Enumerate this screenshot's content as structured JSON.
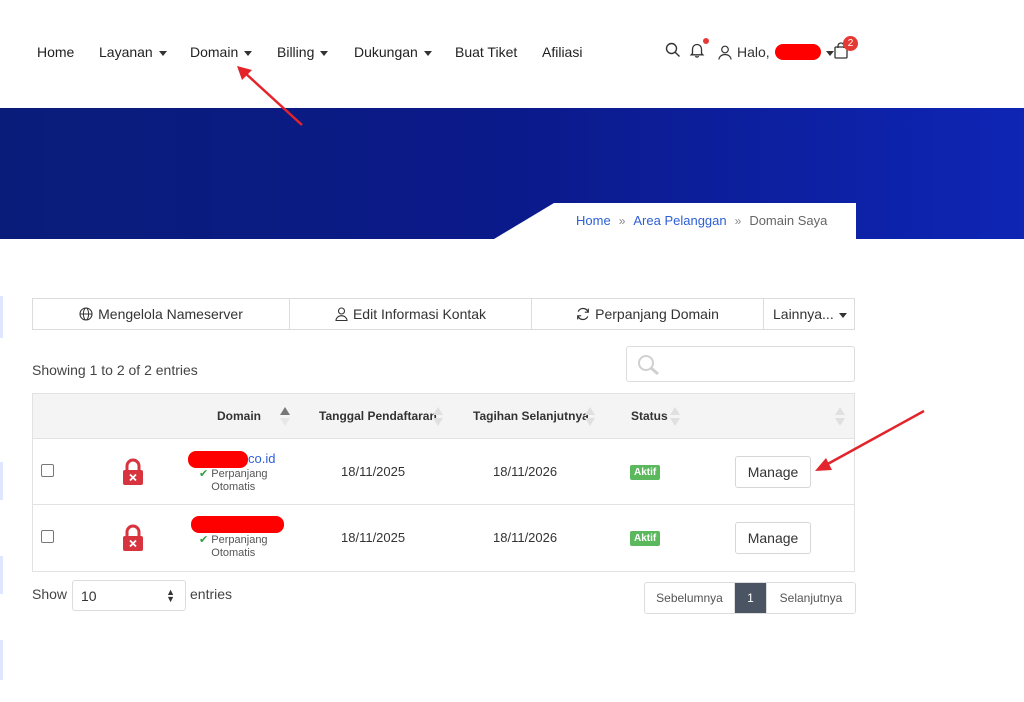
{
  "nav": {
    "items": [
      {
        "label": "Home",
        "caret": false
      },
      {
        "label": "Layanan",
        "caret": true
      },
      {
        "label": "Domain",
        "caret": true
      },
      {
        "label": "Billing",
        "caret": true
      },
      {
        "label": "Dukungan",
        "caret": true
      },
      {
        "label": "Buat Tiket",
        "caret": false
      },
      {
        "label": "Afiliasi",
        "caret": false
      }
    ],
    "greeting": "Halo,",
    "cart_count": "2"
  },
  "breadcrumb": {
    "home": "Home",
    "client_area": "Area Pelanggan",
    "current": "Domain Saya",
    "separator": "»"
  },
  "toolbar": {
    "nameserver": "Mengelola Nameserver",
    "contact": "Edit Informasi Kontak",
    "renew": "Perpanjang Domain",
    "more": "Lainnya..."
  },
  "table_info": "Showing 1 to 2 of 2 entries",
  "table": {
    "headers": {
      "domain": "Domain",
      "registered": "Tanggal Pendaftaran",
      "next_due": "Tagihan Selanjutnya",
      "status": "Status"
    },
    "rows": [
      {
        "domain_suffix": "co.id",
        "auto_renew_1": "Perpanjang",
        "auto_renew_2": "Otomatis",
        "registered": "18/11/2025",
        "next_due": "18/11/2026",
        "status": "Aktif",
        "action": "Manage"
      },
      {
        "domain_suffix": "",
        "auto_renew_1": "Perpanjang",
        "auto_renew_2": "Otomatis",
        "registered": "18/11/2025",
        "next_due": "18/11/2026",
        "status": "Aktif",
        "action": "Manage"
      }
    ]
  },
  "length_menu": {
    "show": "Show",
    "value": "10",
    "entries": "entries"
  },
  "pagination": {
    "prev": "Sebelumnya",
    "current": "1",
    "next": "Selanjutnya"
  },
  "colors": {
    "accent": "#2d5fd6",
    "hero": "#0b1a8a",
    "status_active": "#5cb85c",
    "lock_red": "#d8343f",
    "annotation": "#e3242b"
  }
}
